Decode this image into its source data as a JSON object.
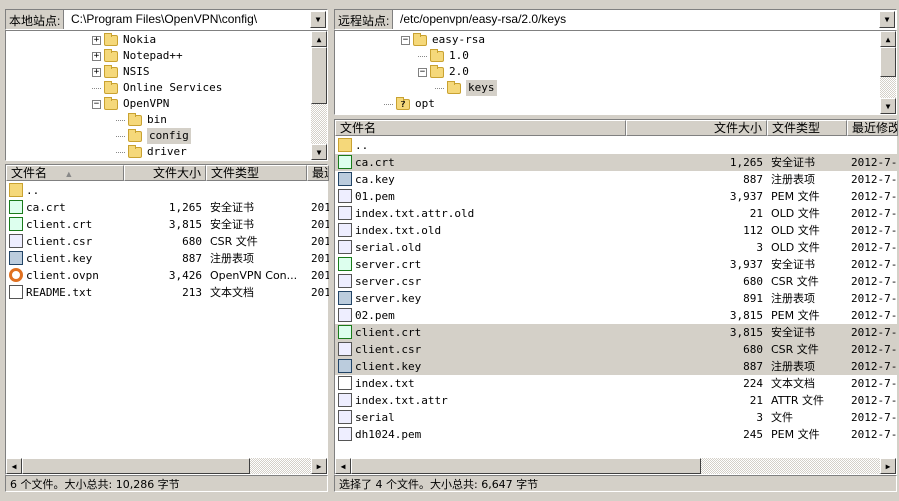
{
  "local": {
    "label": "本地站点:",
    "path": "C:\\Program Files\\OpenVPN\\config\\",
    "tree": [
      {
        "name": "Nokia",
        "exp": "+",
        "level": 0
      },
      {
        "name": "Notepad++",
        "exp": "+",
        "level": 0
      },
      {
        "name": "NSIS",
        "exp": "+",
        "level": 0
      },
      {
        "name": "Online Services",
        "exp": "",
        "level": 0
      },
      {
        "name": "OpenVPN",
        "exp": "-",
        "level": 0
      },
      {
        "name": "bin",
        "exp": "",
        "level": 1
      },
      {
        "name": "config",
        "exp": "",
        "level": 1,
        "selected": true
      },
      {
        "name": "driver",
        "exp": "",
        "level": 1
      }
    ],
    "columns": [
      "文件名",
      "文件大小",
      "文件类型",
      "最近"
    ],
    "sort_indicator": "▲",
    "files": [
      {
        "name": "..",
        "size": "",
        "type": "",
        "date": "",
        "icon": "folder"
      },
      {
        "name": "ca.crt",
        "size": "1,265",
        "type": "安全证书",
        "date": "201",
        "icon": "cert"
      },
      {
        "name": "client.crt",
        "size": "3,815",
        "type": "安全证书",
        "date": "201",
        "icon": "cert"
      },
      {
        "name": "client.csr",
        "size": "680",
        "type": "CSR 文件",
        "date": "201",
        "icon": "gen"
      },
      {
        "name": "client.key",
        "size": "887",
        "type": "注册表项",
        "date": "201",
        "icon": "key"
      },
      {
        "name": "client.ovpn",
        "size": "3,426",
        "type": "OpenVPN Con...",
        "date": "201",
        "icon": "ovpn"
      },
      {
        "name": "README.txt",
        "size": "213",
        "type": "文本文档",
        "date": "201",
        "icon": "txt"
      }
    ],
    "status": "6 个文件。大小总共: 10,286 字节"
  },
  "remote": {
    "label": "远程站点:",
    "path": "/etc/openvpn/easy-rsa/2.0/keys",
    "tree": [
      {
        "name": "easy-rsa",
        "exp": "-",
        "level": 0
      },
      {
        "name": "1.0",
        "exp": "",
        "level": 1
      },
      {
        "name": "2.0",
        "exp": "-",
        "level": 1
      },
      {
        "name": "keys",
        "exp": "",
        "level": 2,
        "selected": true
      },
      {
        "name": "opt",
        "exp": "",
        "level": -1,
        "unknown": true
      }
    ],
    "columns": [
      "文件名",
      "文件大小",
      "文件类型",
      "最近修改"
    ],
    "files": [
      {
        "name": "..",
        "size": "",
        "type": "",
        "date": "",
        "icon": "folder"
      },
      {
        "name": "ca.crt",
        "size": "1,265",
        "type": "安全证书",
        "date": "2012-7-",
        "icon": "cert",
        "selected": true
      },
      {
        "name": "ca.key",
        "size": "887",
        "type": "注册表项",
        "date": "2012-7-",
        "icon": "key"
      },
      {
        "name": "01.pem",
        "size": "3,937",
        "type": "PEM 文件",
        "date": "2012-7-",
        "icon": "gen"
      },
      {
        "name": "index.txt.attr.old",
        "size": "21",
        "type": "OLD 文件",
        "date": "2012-7-",
        "icon": "gen"
      },
      {
        "name": "index.txt.old",
        "size": "112",
        "type": "OLD 文件",
        "date": "2012-7-",
        "icon": "gen"
      },
      {
        "name": "serial.old",
        "size": "3",
        "type": "OLD 文件",
        "date": "2012-7-",
        "icon": "gen"
      },
      {
        "name": "server.crt",
        "size": "3,937",
        "type": "安全证书",
        "date": "2012-7-",
        "icon": "cert"
      },
      {
        "name": "server.csr",
        "size": "680",
        "type": "CSR 文件",
        "date": "2012-7-",
        "icon": "gen"
      },
      {
        "name": "server.key",
        "size": "891",
        "type": "注册表项",
        "date": "2012-7-",
        "icon": "key"
      },
      {
        "name": "02.pem",
        "size": "3,815",
        "type": "PEM 文件",
        "date": "2012-7-",
        "icon": "gen"
      },
      {
        "name": "client.crt",
        "size": "3,815",
        "type": "安全证书",
        "date": "2012-7-",
        "icon": "cert",
        "selected": true
      },
      {
        "name": "client.csr",
        "size": "680",
        "type": "CSR 文件",
        "date": "2012-7-",
        "icon": "gen",
        "selected": true
      },
      {
        "name": "client.key",
        "size": "887",
        "type": "注册表项",
        "date": "2012-7-",
        "icon": "key",
        "selected": true
      },
      {
        "name": "index.txt",
        "size": "224",
        "type": "文本文档",
        "date": "2012-7-",
        "icon": "txt"
      },
      {
        "name": "index.txt.attr",
        "size": "21",
        "type": "ATTR 文件",
        "date": "2012-7-",
        "icon": "gen"
      },
      {
        "name": "serial",
        "size": "3",
        "type": "文件",
        "date": "2012-7-",
        "icon": "gen"
      },
      {
        "name": "dh1024.pem",
        "size": "245",
        "type": "PEM 文件",
        "date": "2012-7-",
        "icon": "gen"
      }
    ],
    "status": "选择了 4 个文件。大小总共: 6,647 字节"
  }
}
